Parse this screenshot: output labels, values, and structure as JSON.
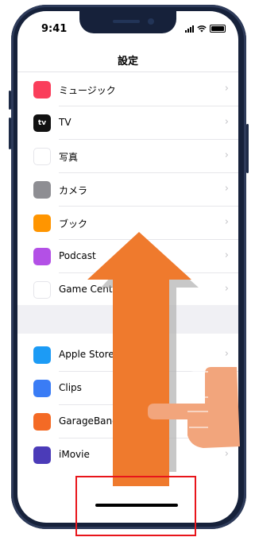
{
  "status_bar": {
    "time": "9:41"
  },
  "nav": {
    "title": "設定"
  },
  "rows": [
    {
      "label": "ミュージック",
      "icon": "music-icon",
      "color": "#fa3e5b"
    },
    {
      "label": "TV",
      "icon": "apple-tv-icon",
      "color": "#111111",
      "glyph": "tv"
    },
    {
      "label": "写真",
      "icon": "photos-icon",
      "color": "#ffffff"
    },
    {
      "label": "カメラ",
      "icon": "camera-icon",
      "color": "#8e8e93"
    },
    {
      "label": "ブック",
      "icon": "books-icon",
      "color": "#ff9500"
    },
    {
      "label": "Podcast",
      "icon": "podcast-icon",
      "color": "#b350e6"
    },
    {
      "label": "Game Center",
      "icon": "game-center-icon",
      "color": "#ffffff"
    },
    {
      "label": "Apple Store",
      "icon": "apple-store-icon",
      "color": "#1c9bf5"
    },
    {
      "label": "Clips",
      "icon": "clips-icon",
      "color": "#3a7cf5"
    },
    {
      "label": "GarageBand",
      "icon": "garageband-icon",
      "color": "#f46a25"
    },
    {
      "label": "iMovie",
      "icon": "imovie-icon",
      "color": "#4b3bb8"
    }
  ],
  "chevron": "›",
  "overlay": {
    "arrow_color": "#ef7a2d",
    "arrow_shadow_color": "#b0b0b0",
    "hand_color": "#f2a57c",
    "highlight_color": "#e8151b"
  }
}
